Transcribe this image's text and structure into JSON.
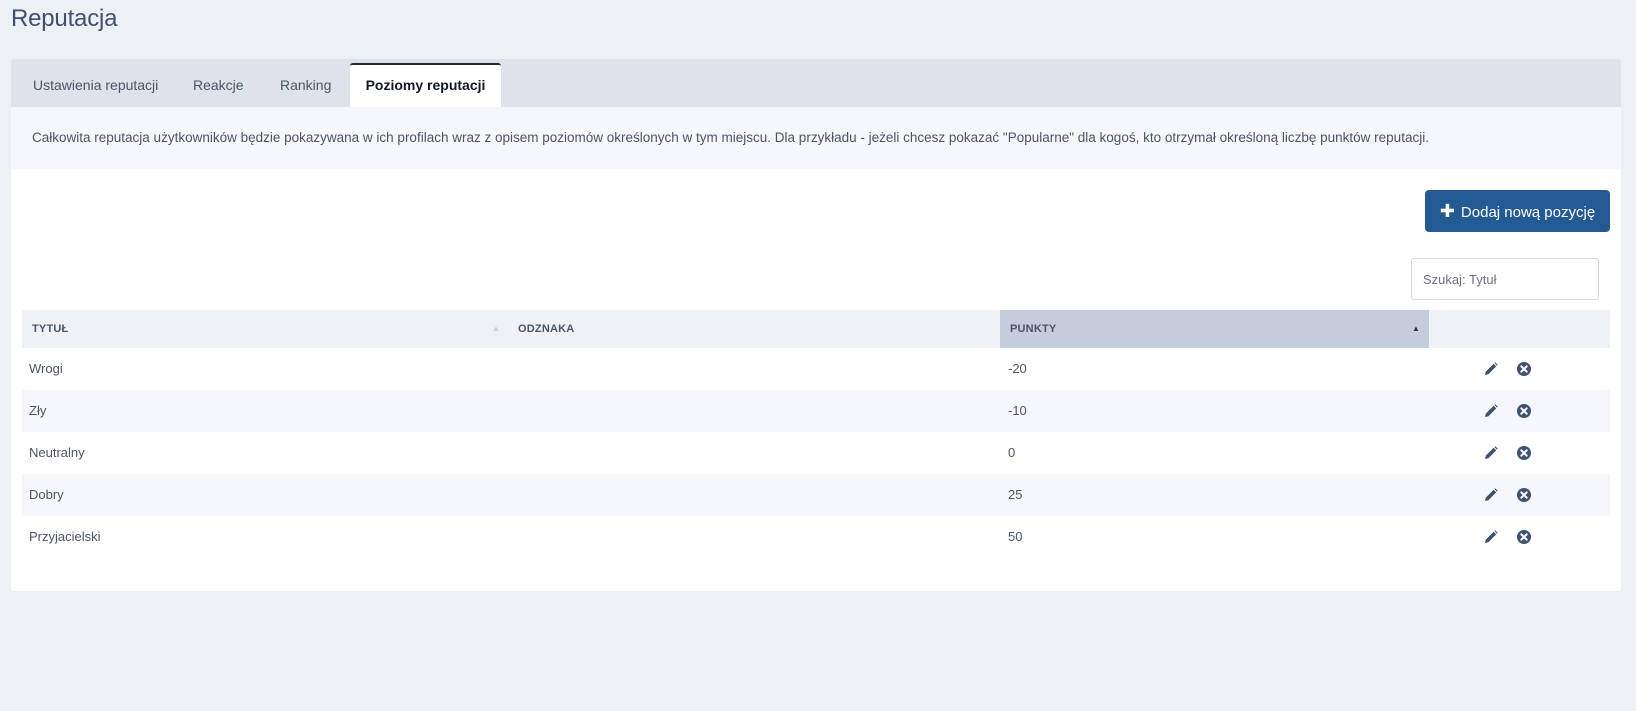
{
  "page": {
    "title": "Reputacja"
  },
  "tabs": [
    {
      "label": "Ustawienia reputacji",
      "active": false
    },
    {
      "label": "Reakcje",
      "active": false
    },
    {
      "label": "Ranking",
      "active": false
    },
    {
      "label": "Poziomy reputacji",
      "active": true
    }
  ],
  "info_text": "Całkowita reputacja użytkowników będzie pokazywana w ich profilach wraz z opisem poziomów określonych w tym miejscu. Dla przykładu - jeżeli chcesz pokazać \"Popularne\" dla kogoś, kto otrzymał określoną liczbę punktów reputacji.",
  "add_button": {
    "label": "Dodaj nową pozycję",
    "icon": "plus-icon"
  },
  "search": {
    "placeholder": "Szukaj: Tytuł",
    "value": ""
  },
  "table": {
    "columns": [
      {
        "label": "TYTUŁ",
        "sortable": true,
        "sorted": false
      },
      {
        "label": "ODZNAKA",
        "sortable": false,
        "sorted": false
      },
      {
        "label": "PUNKTY",
        "sortable": true,
        "sorted": true,
        "direction": "asc"
      }
    ],
    "rows": [
      {
        "title": "Wrogi",
        "badge": "",
        "points": "-20"
      },
      {
        "title": "Zły",
        "badge": "",
        "points": "-10"
      },
      {
        "title": "Neutralny",
        "badge": "",
        "points": "0"
      },
      {
        "title": "Dobry",
        "badge": "",
        "points": "25"
      },
      {
        "title": "Przyjacielski",
        "badge": "",
        "points": "50"
      }
    ],
    "row_actions": [
      "pencil-icon",
      "close-circle-icon"
    ]
  },
  "colors": {
    "primary": "#245a94",
    "title": "#3e5170",
    "tab_bar": "#dde2eb",
    "sorted_header": "#c5ccdb",
    "background": "#edf0f5"
  }
}
